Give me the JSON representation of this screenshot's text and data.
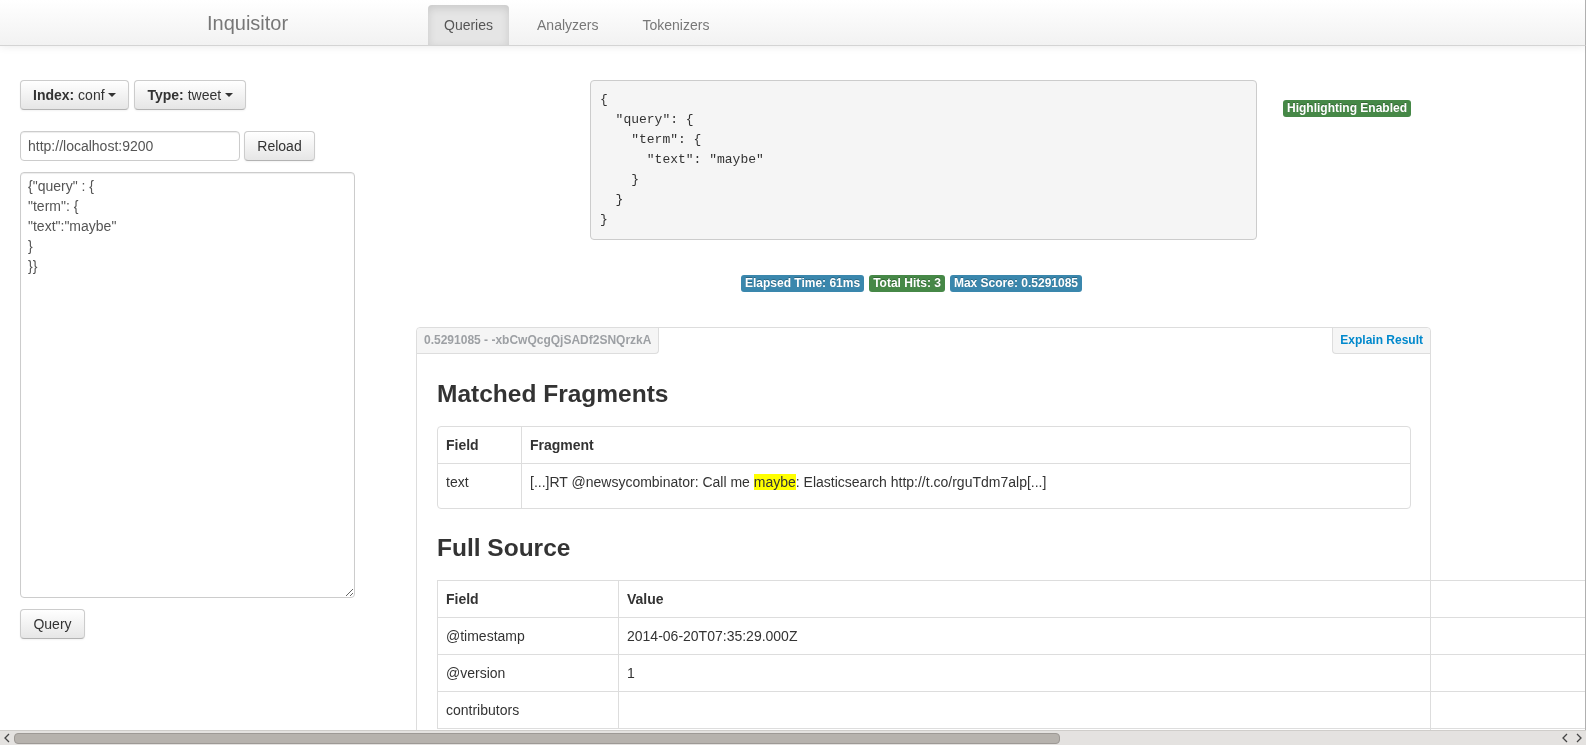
{
  "navbar": {
    "brand": "Inquisitor",
    "tabs": [
      {
        "label": "Queries",
        "selected": true
      },
      {
        "label": "Analyzers",
        "selected": false
      },
      {
        "label": "Tokenizers",
        "selected": false
      }
    ]
  },
  "query_panel": {
    "dropdowns": [
      {
        "label": "Index:",
        "value": "conf"
      },
      {
        "label": "Type:",
        "value": "tweet"
      }
    ],
    "url_field": {
      "value": "http://localhost:9200"
    },
    "reload_button": "Reload",
    "query_editor": {
      "value": "{\"query\" : {\n\"term\": {\n\"text\":\"maybe\"\n}\n}}"
    },
    "query_button": "Query"
  },
  "results": {
    "query_json": "{\n  \"query\": {\n    \"term\": {\n      \"text\": \"maybe\"\n    }\n  }\n}",
    "highlighting_badge": "Highlighting Enabled",
    "stats": [
      {
        "text": "Elapsed Time: 61ms",
        "color": "#3a87ad"
      },
      {
        "text": "Total Hits: 3",
        "color": "#468847"
      },
      {
        "text": "Max Score: 0.5291085",
        "color": "#3a87ad"
      }
    ],
    "hits": [
      {
        "title": "0.5291085 - -xbCwQcgQjSADf2SNQrzkA",
        "explain_link": "Explain Result",
        "matched_fragments": {
          "heading": "Matched Fragments",
          "columns": [
            "Field",
            "Fragment"
          ],
          "rows": [
            {
              "field": "text",
              "fragment": [
                {
                  "text": "[...]RT @newsycombinator: Call me ",
                  "highlighted": false
                },
                {
                  "text": "maybe",
                  "highlighted": true
                },
                {
                  "text": ": Elasticsearch http://t.co/rguTdm7alp[...]",
                  "highlighted": false
                }
              ]
            }
          ]
        },
        "full_source": {
          "heading": "Full Source",
          "columns": [
            "Field",
            "Value"
          ],
          "rows": [
            {
              "field": "@timestamp",
              "value": "2014-06-20T07:35:29.000Z"
            },
            {
              "field": "@version",
              "value": "1"
            },
            {
              "field": "contributors"
            }
          ]
        }
      }
    ]
  }
}
